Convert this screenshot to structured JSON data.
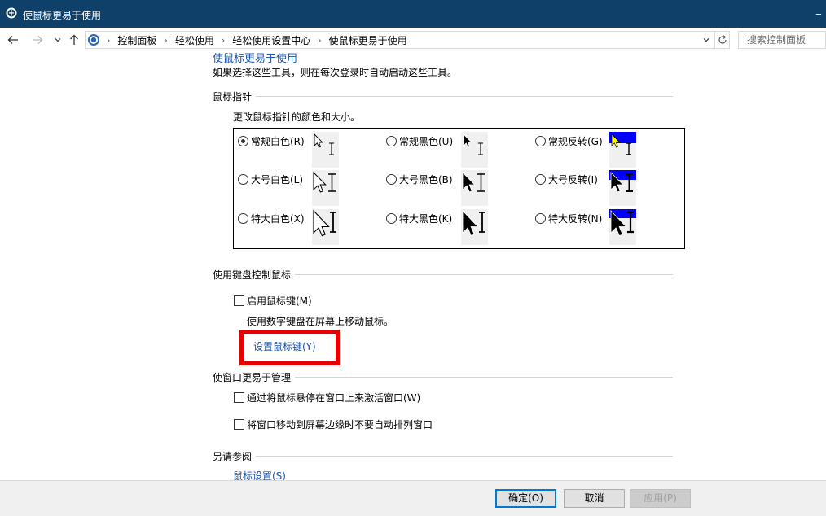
{
  "window": {
    "title": "使鼠标更易于使用",
    "minimize_glyph": "_"
  },
  "address": {
    "breadcrumbs": [
      "控制面板",
      "轻松使用",
      "轻松使用设置中心",
      "使鼠标更易于使用"
    ],
    "separator": "›",
    "search_placeholder": "搜索控制面板"
  },
  "content": {
    "scrolled_heading": "使鼠标更易于使用",
    "intro": "如果选择这些工具，则在每次登录时自动启动这些工具。",
    "pointer_section": {
      "title": "鼠标指针",
      "description": "更改鼠标指针的颜色和大小。",
      "schemes": [
        {
          "label": "常规白色(R)",
          "checked": true
        },
        {
          "label": "常规黑色(U)",
          "checked": false
        },
        {
          "label": "常规反转(G)",
          "checked": false
        },
        {
          "label": "大号白色(L)",
          "checked": false
        },
        {
          "label": "大号黑色(B)",
          "checked": false
        },
        {
          "label": "大号反转(I)",
          "checked": false
        },
        {
          "label": "特大白色(X)",
          "checked": false
        },
        {
          "label": "特大黑色(K)",
          "checked": false
        },
        {
          "label": "特大反转(N)",
          "checked": false
        }
      ]
    },
    "keyboard_section": {
      "title": "使用键盘控制鼠标",
      "enable_label": "启用鼠标键(M)",
      "enable_checked": false,
      "description": "使用数字键盘在屏幕上移动鼠标。",
      "setup_link": "设置鼠标键(Y)"
    },
    "window_section": {
      "title": "使窗口更易于管理",
      "hover_activate_label": "通过将鼠标悬停在窗口上来激活窗口(W)",
      "hover_activate_checked": false,
      "snap_disable_label": "将窗口移动到屏幕边缘时不要自动排列窗口",
      "snap_disable_checked": false
    },
    "see_also": {
      "title": "另请参阅",
      "mouse_settings_link": "鼠标设置(S)"
    }
  },
  "footer": {
    "ok": "确定(O)",
    "cancel": "取消",
    "apply": "应用(P)"
  },
  "colors": {
    "titlebar": "#0f4069",
    "link": "#1a55a8",
    "highlight": "#e60000",
    "invert_blue": "#0000ff",
    "invert_yellow": "#ffff00"
  },
  "icons": {
    "back": "back-arrow-icon",
    "forward": "forward-arrow-icon",
    "recent": "chevron-down-icon",
    "up": "up-arrow-icon",
    "refresh": "refresh-icon"
  }
}
